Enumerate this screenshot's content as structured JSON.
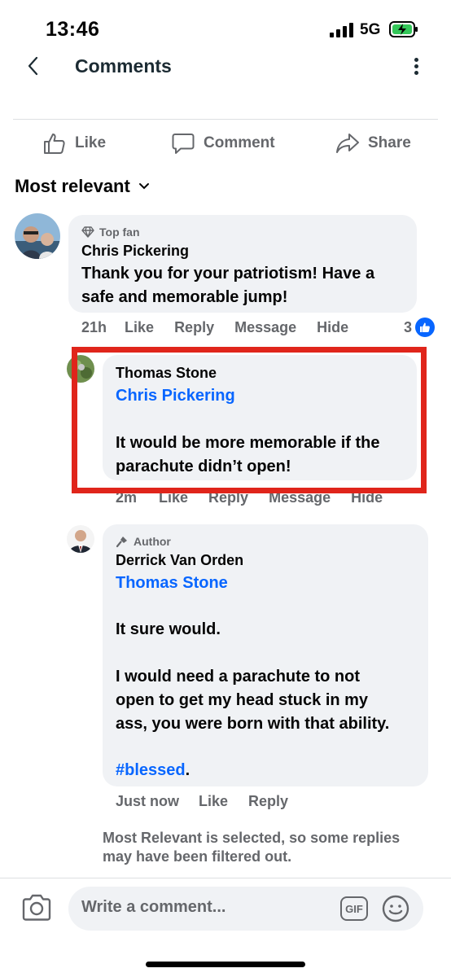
{
  "status_bar": {
    "time": "13:46",
    "network": "5G"
  },
  "header": {
    "title": "Comments"
  },
  "actions": {
    "like": "Like",
    "comment": "Comment",
    "share": "Share"
  },
  "sort": {
    "label": "Most relevant"
  },
  "comments": [
    {
      "badge": "Top fan",
      "author": "Chris Pickering",
      "text_line1": "Thank you for your patriotism!  Have a",
      "text_line2": "safe and memorable jump!",
      "time": "21h",
      "like": "Like",
      "reply": "Reply",
      "message": "Message",
      "hide": "Hide",
      "reactions": "3"
    },
    {
      "author": "Thomas Stone",
      "mention": "Chris Pickering",
      "text_line1": "It would be more memorable if the",
      "text_line2": "parachute didn’t open!",
      "time": "2m",
      "like": "Like",
      "reply": "Reply",
      "message": "Message",
      "hide": "Hide"
    },
    {
      "badge": "Author",
      "author": "Derrick Van Orden",
      "mention": "Thomas Stone",
      "text_p1": "It sure would.",
      "text_p2_line1": "I would need a parachute to not",
      "text_p2_line2": "open to get my head stuck in my",
      "text_p2_line3": "ass, you were born with that ability.",
      "hashtag": "#blessed",
      "hashtag_suffix": ".",
      "time": "Just now",
      "like": "Like",
      "reply": "Reply"
    }
  ],
  "filter_note": "Most Relevant is selected, so some replies may have been filtered out.",
  "composer": {
    "placeholder": "Write a comment...",
    "gif": "GIF"
  },
  "colors": {
    "accent": "#0866ff",
    "highlight": "#e0251b",
    "bubble": "#f0f2f5",
    "muted": "#65676b"
  }
}
